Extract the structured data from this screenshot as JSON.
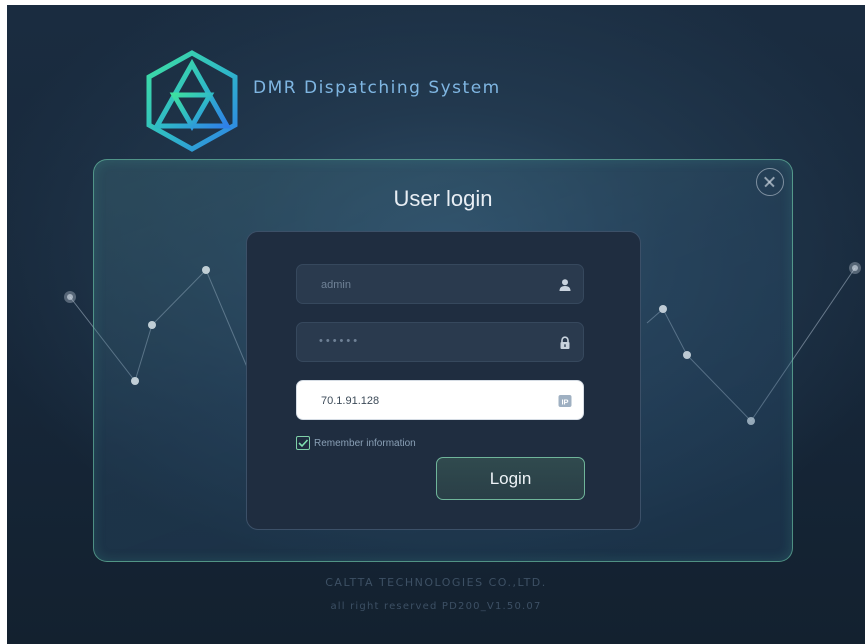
{
  "header": {
    "title": "DMR Dispatching System",
    "logo_icon": "hexagon-triangle-logo-icon"
  },
  "login": {
    "title": "User login",
    "username_placeholder": "admin",
    "password_mask": "••••••",
    "server_ip": "70.1.91.128",
    "remember_label": "Remember information",
    "remember_checked": true,
    "login_label": "Login",
    "icons": {
      "username": "user-icon",
      "password": "lock-icon",
      "server": "ip-badge-icon",
      "close": "close-icon",
      "remember": "check-icon"
    }
  },
  "footer": {
    "company": "CALTTA TECHNOLOGIES CO.,LTD.",
    "copyright": "all right reserved PD200_V1.50.07"
  },
  "colors": {
    "accent_green": "#3ed6a0",
    "accent_blue": "#2f8fe0",
    "title_blue": "#7fb6e2",
    "panel_border": "#78dcb4"
  }
}
